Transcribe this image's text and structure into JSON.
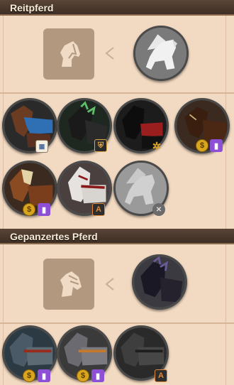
{
  "sections": [
    {
      "title": "Reitpferd"
    },
    {
      "title": "Gepanzertes Pferd"
    }
  ],
  "colors": {
    "background": "#f2d9c1",
    "header": "#4a3a30",
    "slot": "#b39880",
    "twitch": "#8d4fd6",
    "coin": "#d9a521"
  },
  "badges": {
    "shield": "⛨",
    "coin": "$",
    "twitch": "▮",
    "calendar": "▦",
    "cross": "✕",
    "gear": "✲",
    "arena": "A"
  }
}
